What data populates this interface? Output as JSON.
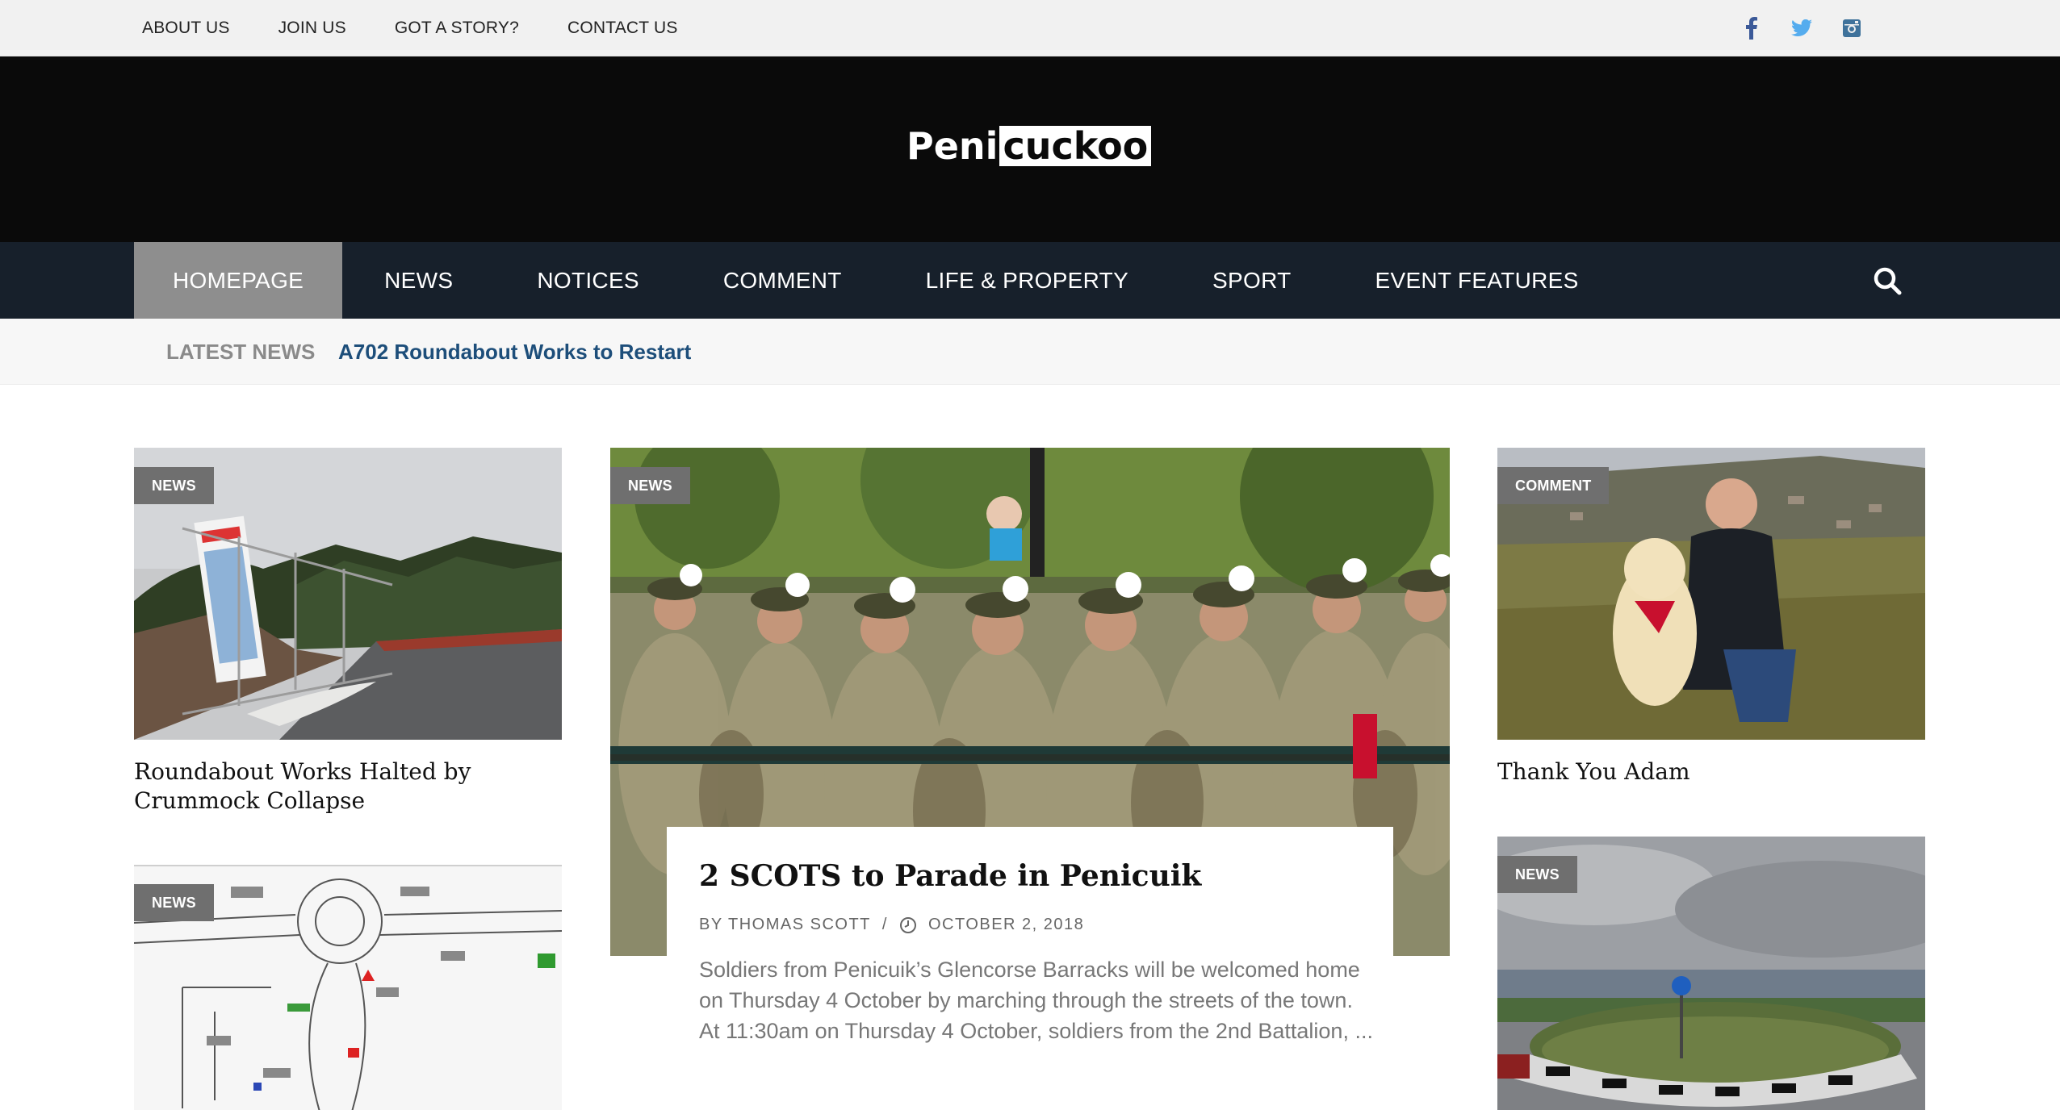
{
  "topbar": {
    "links": [
      "ABOUT US",
      "JOIN US",
      "GOT A STORY?",
      "CONTACT US"
    ],
    "social": [
      "facebook-icon",
      "twitter-icon",
      "instagram-icon"
    ],
    "social_colors": {
      "facebook": "#3b5998",
      "twitter": "#55acee",
      "instagram": "#3f729b"
    }
  },
  "logo": {
    "part1": "Peni",
    "part2": "cuckoo"
  },
  "nav": {
    "items": [
      "HOMEPAGE",
      "NEWS",
      "NOTICES",
      "COMMENT",
      "LIFE & PROPERTY",
      "SPORT",
      "EVENT FEATURES"
    ],
    "active": "HOMEPAGE",
    "search_icon": "search-icon"
  },
  "latest": {
    "label": "LATEST NEWS",
    "headline": "A702 Roundabout Works to Restart"
  },
  "articles": {
    "left_top": {
      "category": "NEWS",
      "title": "Roundabout Works Halted by Crummock Collapse"
    },
    "left_bottom": {
      "category": "NEWS"
    },
    "feature": {
      "category": "NEWS",
      "title": "2 SCOTS to Parade in Penicuik",
      "author": "BY THOMAS SCOTT",
      "separator": "/",
      "date": "OCTOBER 2, 2018",
      "excerpt": "Soldiers from Penicuik’s Glencorse Barracks will be welcomed home on Thursday 4 October by marching through the streets of the town. At 11:30am on Thursday 4 October, soldiers from the 2nd Battalion, ..."
    },
    "right_top": {
      "category": "COMMENT",
      "title": "Thank You Adam"
    },
    "right_bottom": {
      "category": "NEWS"
    }
  },
  "colors": {
    "header_bg": "#0a0a0a",
    "nav_bg": "#17202b",
    "nav_active": "#8e8e8e",
    "badge": "#6f6f6f",
    "latest_link": "#1d4e7a"
  }
}
